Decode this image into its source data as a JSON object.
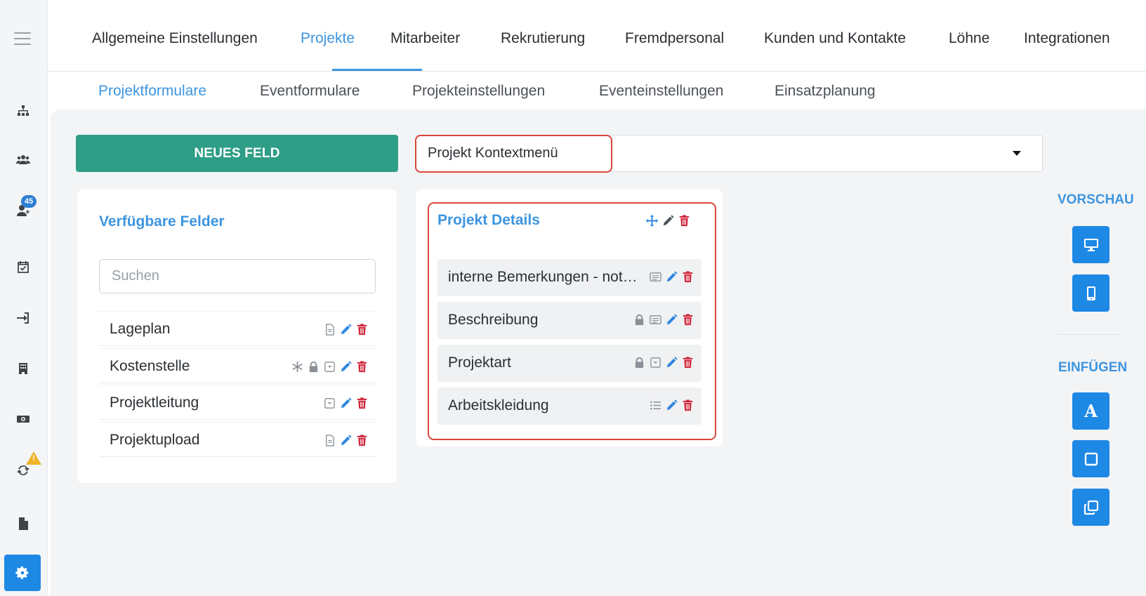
{
  "top_tabs": [
    {
      "label": "Allgemeine Einstellungen"
    },
    {
      "label": "Projekte",
      "active": true
    },
    {
      "label": "Mitarbeiter"
    },
    {
      "label": "Rekrutierung"
    },
    {
      "label": "Fremdpersonal"
    },
    {
      "label": "Kunden und Kontakte"
    },
    {
      "label": "Löhne"
    },
    {
      "label": "Integrationen"
    }
  ],
  "sub_tabs": [
    {
      "label": "Projektformulare",
      "active": true
    },
    {
      "label": "Eventformulare"
    },
    {
      "label": "Projekteinstellungen"
    },
    {
      "label": "Eventeinstellungen"
    },
    {
      "label": "Einsatzplanung"
    }
  ],
  "sidebar": {
    "items": [
      {
        "icon": "sitemap-icon"
      },
      {
        "icon": "users-icon"
      },
      {
        "icon": "user-plus-icon",
        "badge": "45"
      },
      {
        "icon": "calendar-check-icon"
      },
      {
        "icon": "sign-in-icon"
      },
      {
        "icon": "building-icon"
      },
      {
        "icon": "money-icon"
      },
      {
        "icon": "sync-icon",
        "warning": true
      },
      {
        "icon": "file-icon"
      },
      {
        "icon": "gear-icon",
        "active": true
      }
    ]
  },
  "toolbar": {
    "new_field_label": "NEUES FELD",
    "context_select_value": "Projekt Kontextmenü"
  },
  "available_fields": {
    "title": "Verfügbare Felder",
    "search_placeholder": "Suchen",
    "items": [
      {
        "label": "Lageplan",
        "icons": [
          "document-icon",
          "pencil-icon",
          "trash-icon"
        ]
      },
      {
        "label": "Kostenstelle",
        "icons": [
          "asterisk-icon",
          "lock-icon",
          "dropdown-icon",
          "pencil-icon",
          "trash-icon"
        ]
      },
      {
        "label": "Projektleitung",
        "icons": [
          "dropdown-icon",
          "pencil-icon",
          "trash-icon"
        ]
      },
      {
        "label": "Projektupload",
        "icons": [
          "document-icon",
          "pencil-icon",
          "trash-icon"
        ]
      }
    ]
  },
  "project_details": {
    "title": "Projekt Details",
    "items": [
      {
        "label": "interne Bemerkungen - notizen",
        "icons": [
          "textarea-icon",
          "pencil-icon",
          "trash-icon"
        ]
      },
      {
        "label": "Beschreibung",
        "icons": [
          "lock-icon",
          "textarea-icon",
          "pencil-icon",
          "trash-icon"
        ]
      },
      {
        "label": "Projektart",
        "icons": [
          "lock-icon",
          "dropdown-icon",
          "pencil-icon",
          "trash-icon"
        ]
      },
      {
        "label": "Arbeitskleidung",
        "icons": [
          "list-icon",
          "pencil-icon",
          "trash-icon"
        ]
      }
    ]
  },
  "right_panel": {
    "preview_title": "VORSCHAU",
    "insert_title": "EINFÜGEN",
    "preview_buttons": [
      "desktop-icon",
      "mobile-icon"
    ],
    "insert_buttons": [
      "text-icon",
      "box-icon",
      "copy-icon"
    ]
  },
  "colors": {
    "accent": "#3d95e0",
    "primary_button": "#2f9e86",
    "danger": "#d0253a",
    "highlight_border": "#d9463b",
    "icon_button": "#1e88e5"
  }
}
